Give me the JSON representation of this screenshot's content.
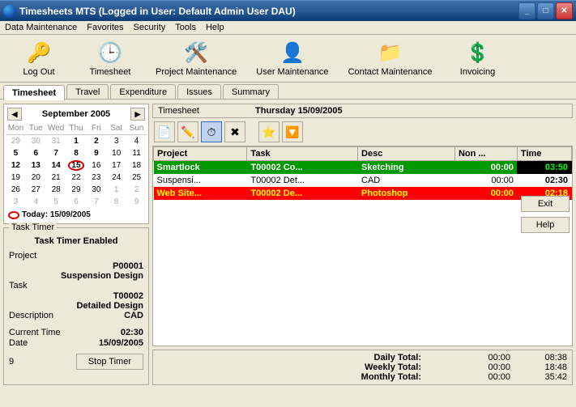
{
  "window": {
    "title": "Timesheets MTS (Logged in User: Default Admin User DAU)"
  },
  "menu": {
    "data_maintenance": "Data Maintenance",
    "favorites": "Favorites",
    "security": "Security",
    "tools": "Tools",
    "help": "Help"
  },
  "toolbar": {
    "logout": "Log Out",
    "timesheet": "Timesheet",
    "project_maintenance": "Project Maintenance",
    "user_maintenance": "User Maintenance",
    "contact_maintenance": "Contact Maintenance",
    "invoicing": "Invoicing"
  },
  "tabs": {
    "timesheet": "Timesheet",
    "travel": "Travel",
    "expenditure": "Expenditure",
    "issues": "Issues",
    "summary": "Summary"
  },
  "sidebuttons": {
    "exit": "Exit",
    "help": "Help"
  },
  "calendar": {
    "month_label": "September 2005",
    "day_headers": [
      "Mon",
      "Tue",
      "Wed",
      "Thu",
      "Fri",
      "Sat",
      "Sun"
    ],
    "today_label": "Today: 15/09/2005"
  },
  "timer": {
    "legend": "Task Timer",
    "title": "Task Timer Enabled",
    "project_label": "Project",
    "project_code": "P00001",
    "project_name": "Suspension Design",
    "task_label": "Task",
    "task_code": "T00002",
    "task_name": "Detailed Design",
    "desc_label": "Description",
    "desc_value": "CAD",
    "current_time_label": "Current Time",
    "current_time_value": "02:30",
    "date_label": "Date",
    "date_value": "15/09/2005",
    "counter": "9",
    "stop_label": "Stop Timer"
  },
  "timesheet": {
    "panel_label": "Timesheet",
    "date": "Thursday 15/09/2005",
    "columns": {
      "project": "Project",
      "task": "Task",
      "desc": "Desc",
      "non": "Non ...",
      "time": "Time"
    },
    "rows": [
      {
        "project": "Smartlock",
        "task": "T00002 Co...",
        "desc": "Sketching",
        "non": "00:00",
        "time": "03:50",
        "cls": "green"
      },
      {
        "project": "Suspensi...",
        "task": "T00002 Det...",
        "desc": "CAD",
        "non": "00:00",
        "time": "02:30",
        "cls": "white"
      },
      {
        "project": "Web Site...",
        "task": "T00002 De...",
        "desc": "Photoshop",
        "non": "00:00",
        "time": "02:18",
        "cls": "red"
      }
    ],
    "totals": {
      "daily_label": "Daily Total:",
      "daily_non": "00:00",
      "daily_time": "08:38",
      "weekly_label": "Weekly Total:",
      "weekly_non": "00:00",
      "weekly_time": "18:48",
      "monthly_label": "Monthly Total:",
      "monthly_non": "00:00",
      "monthly_time": "35:42"
    }
  }
}
